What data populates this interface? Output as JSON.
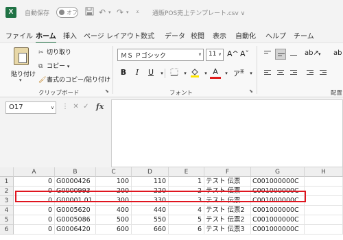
{
  "titlebar": {
    "logo_letter": "X",
    "autosave_label": "自動保存",
    "autosave_state": "オフ",
    "save_icon": "save-icon",
    "undo_icon": "undo-icon",
    "redo_icon": "redo-icon",
    "file_title": "通販POS売上テンプレート.csv",
    "title_caret": "∨"
  },
  "tabs": [
    "ファイル",
    "ホーム",
    "挿入",
    "ページ レイアウト",
    "数式",
    "データ",
    "校閲",
    "表示",
    "自動化",
    "ヘルプ",
    "チーム"
  ],
  "active_tab": "ホーム",
  "clipboard": {
    "paste": "貼り付け",
    "cut": "切り取り",
    "copy": "コピー",
    "format_painter": "書式のコピー/貼り付け",
    "group": "クリップボード"
  },
  "font": {
    "name": "ＭＳ Ｐゴシック",
    "size": "11",
    "grow": "A^",
    "shrink": "Aˇ",
    "bold": "B",
    "italic": "I",
    "underline": "U",
    "font_color": "A",
    "group": "フォント",
    "fill_color_hex": "#ffe600",
    "font_color_hex": "#e01b1b"
  },
  "alignment": {
    "group": "配置"
  },
  "formula_bar": {
    "name_box": "O17",
    "cancel": "✕",
    "enter": "✓",
    "fx": "fx",
    "formula": ""
  },
  "grid": {
    "columns": [
      "A",
      "B",
      "C",
      "D",
      "E",
      "F",
      "G",
      "H"
    ],
    "rows": [
      {
        "num": "1",
        "A": "0",
        "B": "G0000426",
        "C": "100",
        "D": "110",
        "E": "1",
        "F": "テスト 伝票",
        "G": "C001000000C"
      },
      {
        "num": "2",
        "A": "0",
        "B": "G0000993",
        "C": "200",
        "D": "220",
        "E": "2",
        "F": "テスト 伝票",
        "G": "C001000000C"
      },
      {
        "num": "3",
        "A": "0",
        "B": "G00001 01",
        "C": "300",
        "D": "330",
        "E": "3",
        "F": "テスト 伝票",
        "G": "C001000000C"
      },
      {
        "num": "4",
        "A": "0",
        "B": "G0005620",
        "C": "400",
        "D": "440",
        "E": "4",
        "F": "テスト 伝票2",
        "G": "C001000000C"
      },
      {
        "num": "5",
        "A": "0",
        "B": "G0005086",
        "C": "500",
        "D": "550",
        "E": "5",
        "F": "テスト 伝票2",
        "G": "C001000000C"
      },
      {
        "num": "6",
        "A": "0",
        "B": "G0006420",
        "C": "600",
        "D": "660",
        "E": "6",
        "F": "テスト 伝票3",
        "G": "C001000000C"
      }
    ],
    "highlight_color": "#e0151f"
  }
}
